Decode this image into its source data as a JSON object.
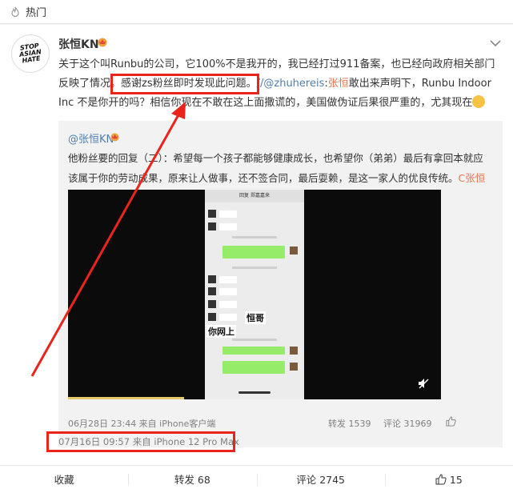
{
  "hot": {
    "label": "热门"
  },
  "post": {
    "avatar_text": "STOP ASIAN HATE",
    "username": "张恒KN",
    "text_part1": "关于这个叫Runbu的公司，它100%不是我开的，我已经打过911备案，也已经向政府相关部门反映了情况。",
    "text_highlight": "感谢zs粉丝即时发现此问题。",
    "text_mention": "//@zhuhereis",
    "text_mention_sep": ":",
    "text_name": "张恒",
    "text_part2": "敢出来声明下，Runbu Indoor Inc 不是你开的吗？相信你现在不敢在这上面撒谎的，美国做伪证后果很严重的，尤其现在",
    "time": "07月16日 09:57  来自 iPhone 12 Pro Max"
  },
  "repost": {
    "user": "@张恒KN",
    "text": "他粉丝要的回复（二）：希望每一个孩子都能够健康成长，也希望你（弟弟）最后有拿回本就应该属于你的劳动成果，原来让人做事，还不签合同，最后耍赖，是这一家人的优良传统。",
    "link_text": "C张恒KN的",
    "meta": "06月28日 23:44 来自 iPhone客户端",
    "forward": "转发 1539",
    "comment": "评论 31969",
    "video": {
      "phone_header": "回复  郑嘉嘉来",
      "overlay1": "恒哥",
      "overlay2": "你网上"
    }
  },
  "actions": {
    "favorite": "收藏",
    "forward": "转发 68",
    "comment": "评论 2745",
    "like": "15"
  },
  "colors": {
    "link_orange": "#eb7350",
    "link_blue": "#507daf",
    "annotation_red": "#e8241b"
  }
}
